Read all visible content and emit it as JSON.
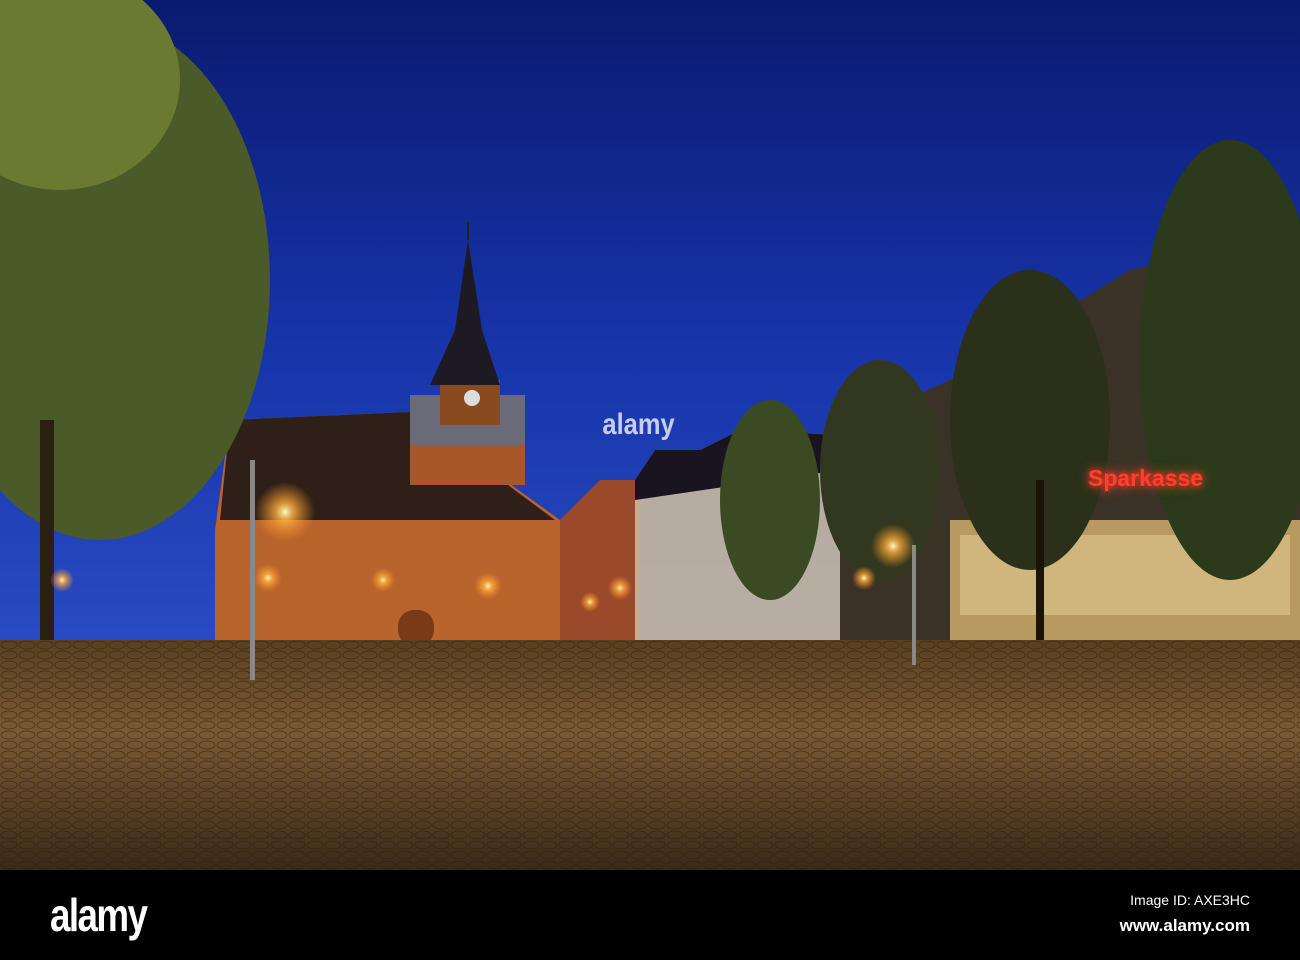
{
  "scene": {
    "sign_text": "Sparkasse",
    "watermark_text": "alamy"
  },
  "footer": {
    "logo": "alamy",
    "image_id": "Image ID: AXE3HC",
    "url": "www.alamy.com"
  }
}
